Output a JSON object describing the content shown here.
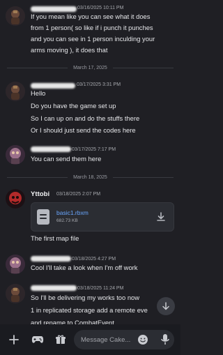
{
  "messages": {
    "m1": {
      "timestamp": "03/16/2025 10:11 PM",
      "lines": [
        "If you mean like you can see what it does",
        "from 1 person( so like if i punch it punches",
        "and you can see in 1 person inculding your",
        "arms moving ), it does that"
      ]
    },
    "divider1": "March 17, 2025",
    "m2": {
      "timestamp": "03/17/2025 3:31 PM",
      "lines": [
        "Hello",
        "Do you have the game set up",
        "So I can up on and do the stuffs there",
        "Or I should just send the codes here"
      ]
    },
    "m3": {
      "timestamp": "03/17/2025 7:17 PM",
      "lines": [
        "You can send them here"
      ]
    },
    "divider2": "March 18, 2025",
    "m4": {
      "author": "Yttobi",
      "timestamp": "03/18/2025 2:07 PM",
      "file": {
        "name": "basic1.rbxm",
        "size": "682.73 KB"
      },
      "lines": [
        "The first map file"
      ]
    },
    "m5": {
      "timestamp": "03/18/2025 4:27 PM",
      "lines": [
        "Cool I'll take a look when I'm off work"
      ]
    },
    "m6": {
      "timestamp": "03/18/2025 11:24 PM",
      "lines": [
        "So I'll be delivering my works too now",
        "1 in replicated storage add a remote eve",
        "and rename to CombatEvent"
      ]
    }
  },
  "composer": {
    "placeholder": "Message Cake..."
  },
  "colors": {
    "background": "#1f1f24",
    "link": "#6aa7ff"
  }
}
